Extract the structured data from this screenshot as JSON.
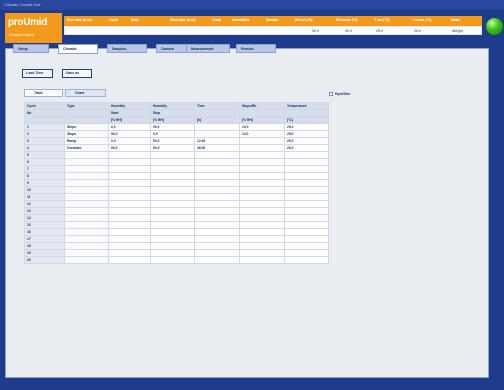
{
  "window": {
    "title": "Climatic Control Unit"
  },
  "logo": {
    "name": "proUmid",
    "tagline": "Analysis Control"
  },
  "status": {
    "headers": [
      "Run time (h:m)",
      "Cycle",
      "Step",
      "Step time (h:m)",
      "Temp",
      "Humidifier",
      "Sample",
      "RH set (%)",
      "RH meas (%)",
      "T set (°C)",
      "T meas (°C)",
      "Mode"
    ],
    "values": [
      "",
      "",
      "",
      "",
      "",
      "",
      "",
      "90,0",
      "90,0",
      "25,0",
      "25,0",
      "Weight"
    ]
  },
  "tabs": [
    "Setup",
    "Climatic",
    "Samples",
    "Camera",
    "Measurement",
    "Results"
  ],
  "active_tab": 1,
  "buttons": {
    "load": "Load Time",
    "save": "Save as"
  },
  "subtabs": [
    "Table",
    "Chart"
  ],
  "checkbox_label": "Hyst/Ster",
  "table": {
    "headers1": [
      "Cycle",
      "Type",
      "Humidity",
      "Humidity",
      "Time",
      "Steps/Rh",
      "Temperature"
    ],
    "headers2": [
      "No",
      "",
      "Start",
      "Stop",
      "",
      "",
      ""
    ],
    "headers3": [
      "",
      "",
      "[% RH]",
      "[% RH]",
      "[h]",
      "[% RH]",
      "[°C]"
    ],
    "rows": [
      [
        "1",
        "Steps",
        "0,0",
        "90,0",
        "",
        "10,0",
        "25,0"
      ],
      [
        "2",
        "Steps",
        "90,0",
        "0,0",
        "",
        "10,0",
        "25,0"
      ],
      [
        "3",
        "Ramp",
        "0,0",
        "50,0",
        "12,00",
        "",
        "25,0"
      ],
      [
        "4",
        "Constant",
        "50,0",
        "50,0",
        "48,00",
        "",
        "25,0"
      ],
      [
        "5",
        "",
        "",
        "",
        "",
        "",
        ""
      ],
      [
        "6",
        "",
        "",
        "",
        "",
        "",
        ""
      ],
      [
        "7",
        "",
        "",
        "",
        "",
        "",
        ""
      ],
      [
        "8",
        "",
        "",
        "",
        "",
        "",
        ""
      ],
      [
        "9",
        "",
        "",
        "",
        "",
        "",
        ""
      ],
      [
        "10",
        "",
        "",
        "",
        "",
        "",
        ""
      ],
      [
        "11",
        "",
        "",
        "",
        "",
        "",
        ""
      ],
      [
        "12",
        "",
        "",
        "",
        "",
        "",
        ""
      ],
      [
        "13",
        "",
        "",
        "",
        "",
        "",
        ""
      ],
      [
        "14",
        "",
        "",
        "",
        "",
        "",
        ""
      ],
      [
        "15",
        "",
        "",
        "",
        "",
        "",
        ""
      ],
      [
        "16",
        "",
        "",
        "",
        "",
        "",
        ""
      ],
      [
        "17",
        "",
        "",
        "",
        "",
        "",
        ""
      ],
      [
        "18",
        "",
        "",
        "",
        "",
        "",
        ""
      ],
      [
        "19",
        "",
        "",
        "",
        "",
        "",
        ""
      ],
      [
        "20",
        "",
        "",
        "",
        "",
        "",
        ""
      ]
    ]
  }
}
